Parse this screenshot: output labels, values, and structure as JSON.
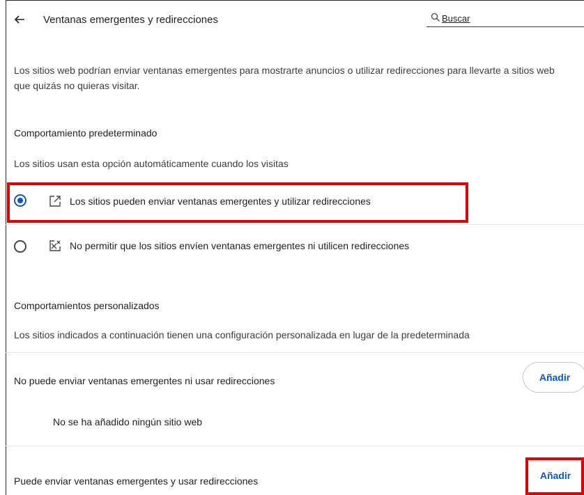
{
  "header": {
    "title": "Ventanas emergentes y redirecciones",
    "search_placeholder": "Buscar"
  },
  "intro": "Los sitios web podrían enviar ventanas emergentes para mostrarte anuncios o utilizar redirecciones para llevarte a sitios web que quizás no quieras visitar.",
  "default_behavior": {
    "heading": "Comportamiento predeterminado",
    "description": "Los sitios usan esta opción automáticamente cuando los visitas",
    "options": [
      {
        "label": "Los sitios pueden enviar ventanas emergentes y utilizar redirecciones",
        "selected": true,
        "icon": "open-in-new-icon"
      },
      {
        "label": "No permitir que los sitios envíen ventanas emergentes ni utilicen redirecciones",
        "selected": false,
        "icon": "popup-blocked-icon"
      }
    ]
  },
  "custom_behavior": {
    "heading": "Comportamientos personalizados",
    "description": "Los sitios indicados a continuación tienen una configuración personalizada en lugar de la predeterminada",
    "blocked": {
      "label": "No puede enviar ventanas emergentes ni usar redirecciones",
      "add_label": "Añadir",
      "empty_text": "No se ha añadido ningún sitio web"
    },
    "allowed": {
      "label": "Puede enviar ventanas emergentes y usar redirecciones",
      "add_label": "Añadir"
    }
  },
  "colors": {
    "accent": "#0b57d0",
    "highlight": "#e00000"
  }
}
